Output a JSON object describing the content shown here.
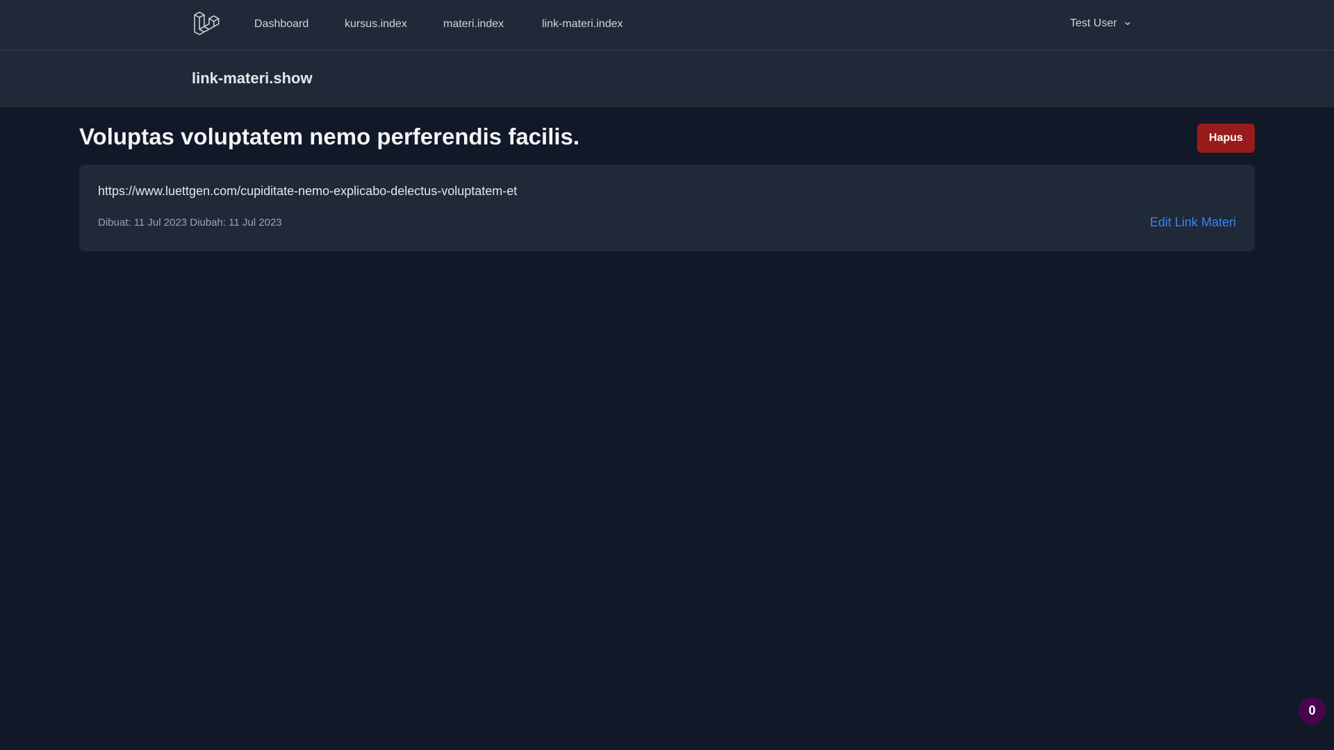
{
  "nav": {
    "logo_icon": "laravel-logo-icon",
    "links": [
      {
        "label": "Dashboard"
      },
      {
        "label": "kursus.index"
      },
      {
        "label": "materi.index"
      },
      {
        "label": "link-materi.index"
      }
    ],
    "user": {
      "name": "Test User",
      "icon": "chevron-down-icon"
    }
  },
  "header": {
    "title": "link-materi.show"
  },
  "main": {
    "title": "Voluptas voluptatem nemo perferendis facilis.",
    "delete_label": "Hapus",
    "card": {
      "url": "https://www.luettgen.com/cupiditate-nemo-explicabo-delectus-voluptatem-et",
      "meta": "Dibuat: 11 Jul 2023 Diubah: 11 Jul 2023",
      "edit_label": "Edit Link Materi"
    }
  },
  "badge": {
    "count": "0"
  },
  "colors": {
    "background": "#111827",
    "surface": "#1f2937",
    "danger": "#991b1b",
    "link": "#3b82f6",
    "badge": "#4a044e"
  }
}
